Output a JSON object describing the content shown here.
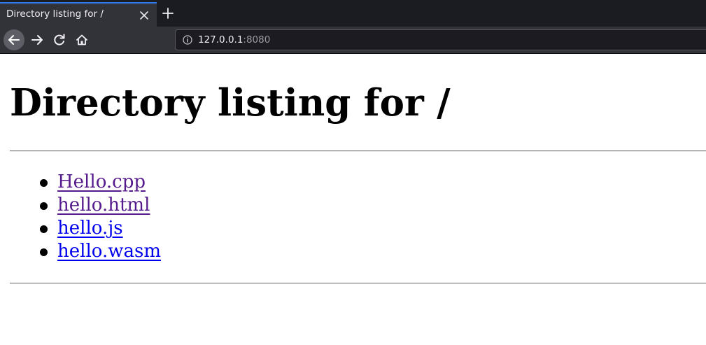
{
  "browser": {
    "tab": {
      "title": "Directory listing for /"
    },
    "address_bar": {
      "host": "127.0.0.1",
      "port": ":8080"
    }
  },
  "page": {
    "heading": "Directory listing for /",
    "files": [
      {
        "name": "Hello.cpp",
        "visited": true
      },
      {
        "name": "hello.html",
        "visited": true
      },
      {
        "name": "hello.js",
        "visited": false
      },
      {
        "name": "hello.wasm",
        "visited": false
      }
    ]
  },
  "colors": {
    "visited_link": "#551a8b",
    "unvisited_link": "#0000ee",
    "active_tab_accent": "#2f7ff2",
    "chrome_background": "#323239"
  },
  "icons": {
    "tab_close": "close-icon",
    "new_tab": "plus-icon",
    "back": "back-arrow-icon",
    "forward": "forward-arrow-icon",
    "reload": "reload-icon",
    "home": "home-icon",
    "site_info": "info-icon"
  }
}
